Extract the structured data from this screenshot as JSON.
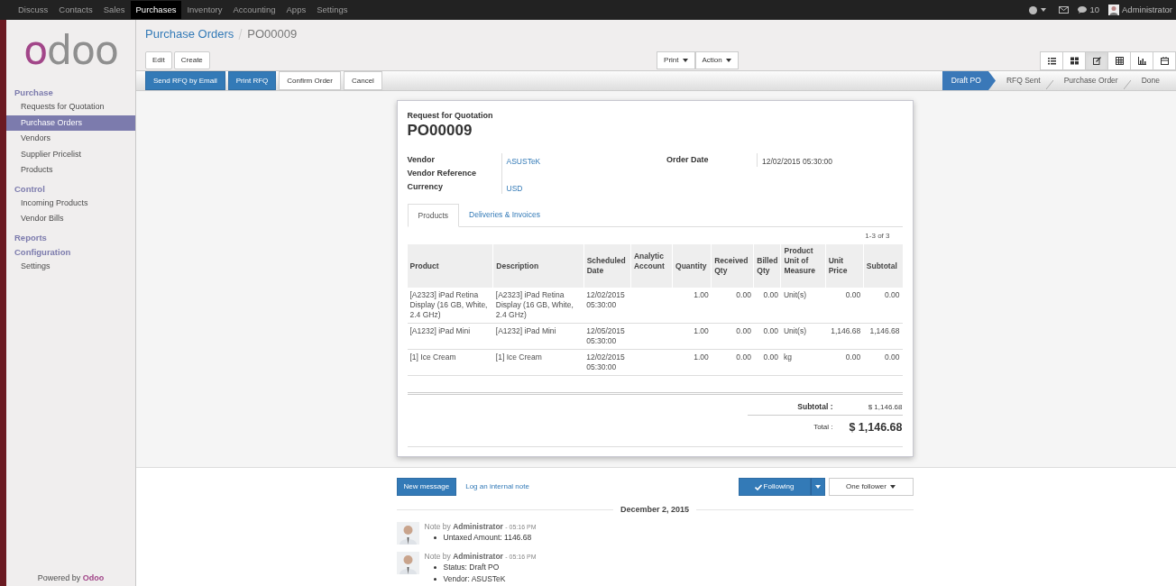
{
  "top_menu": [
    {
      "label": "Discuss",
      "selected": false
    },
    {
      "label": "Contacts",
      "selected": false
    },
    {
      "label": "Sales",
      "selected": false
    },
    {
      "label": "Purchases",
      "selected": true
    },
    {
      "label": "Inventory",
      "selected": false
    },
    {
      "label": "Accounting",
      "selected": false
    },
    {
      "label": "Apps",
      "selected": false
    },
    {
      "label": "Settings",
      "selected": false
    }
  ],
  "top_right": {
    "message_count": "10",
    "user": "Administrator"
  },
  "logo": "odoo",
  "sidebar": {
    "sections": [
      {
        "title": "Purchase",
        "items": [
          {
            "label": "Requests for Quotation",
            "selected": false
          },
          {
            "label": "Purchase Orders",
            "selected": true
          },
          {
            "label": "Vendors",
            "selected": false
          },
          {
            "label": "Supplier Pricelist",
            "selected": false
          },
          {
            "label": "Products",
            "selected": false
          }
        ]
      },
      {
        "title": "Control",
        "items": [
          {
            "label": "Incoming Products",
            "selected": false
          },
          {
            "label": "Vendor Bills",
            "selected": false
          }
        ]
      },
      {
        "title": "Reports"
      },
      {
        "title": "Configuration",
        "items": [
          {
            "label": "Settings",
            "selected": false
          }
        ]
      }
    ],
    "footer_prefix": "Powered by",
    "footer_brand": "Odoo"
  },
  "breadcrumb": {
    "parent": "Purchase Orders",
    "current": "PO00009"
  },
  "toolbar": {
    "left_buttons": [
      "Edit",
      "Create"
    ],
    "dropdowns": [
      "Print",
      "Action"
    ],
    "views": [
      {
        "kind": "list",
        "selected": false
      },
      {
        "kind": "kanban",
        "selected": false
      },
      {
        "kind": "form",
        "selected": true
      },
      {
        "kind": "pivot",
        "selected": false
      },
      {
        "kind": "graph",
        "selected": false
      },
      {
        "kind": "calendar",
        "selected": false
      }
    ]
  },
  "action_buttons": [
    {
      "label": "Send RFQ by Email",
      "primary": true
    },
    {
      "label": "Print RFQ",
      "primary": true
    },
    {
      "label": "Confirm Order",
      "primary": false
    },
    {
      "label": "Cancel",
      "primary": false
    }
  ],
  "status_steps": [
    {
      "label": "Draft PO",
      "selected": true
    },
    {
      "label": "RFQ Sent",
      "selected": false
    },
    {
      "label": "Purchase Order",
      "selected": false
    },
    {
      "label": "Done",
      "selected": false
    }
  ],
  "form": {
    "subtitle": "Request for Quotation",
    "title": "PO00009",
    "left_fields": [
      {
        "label": "Vendor",
        "value": "ASUSTeK"
      },
      {
        "label": "Vendor Reference"
      },
      {
        "label": "Currency",
        "value": "USD"
      }
    ],
    "right_fields": [
      {
        "label": "Order Date",
        "value": "12/02/2015 05:30:00"
      }
    ],
    "tabs": [
      {
        "label": "Products",
        "selected": true
      },
      {
        "label": "Deliveries & Invoices",
        "selected": false
      }
    ],
    "pager": "1-3 of 3",
    "table": {
      "columns": [
        "Product",
        "Description",
        "Scheduled Date",
        "Analytic Account",
        "Quantity",
        "Received Qty",
        "Billed Qty",
        "Product Unit of Measure",
        "Unit Price",
        "Subtotal"
      ],
      "rows": [
        [
          "[A2323] iPad Retina Display (16 GB, White, 2.4 GHz)",
          "[A2323] iPad Retina Display (16 GB, White, 2.4 GHz)",
          "12/02/2015 05:30:00",
          "",
          "1.00",
          "0.00",
          "0.00",
          "Unit(s)",
          "0.00",
          "0.00"
        ],
        [
          "[A1232] iPad Mini",
          "[A1232] iPad Mini",
          "12/05/2015 05:30:00",
          "",
          "1.00",
          "0.00",
          "0.00",
          "Unit(s)",
          "1,146.68",
          "1,146.68"
        ],
        [
          "[1] Ice Cream",
          "[1] Ice Cream",
          "12/02/2015 05:30:00",
          "",
          "1.00",
          "0.00",
          "0.00",
          "kg",
          "0.00",
          "0.00"
        ]
      ]
    },
    "subtotal_label": "Subtotal :",
    "subtotal": "$ 1,146.68",
    "total_label": "Total :",
    "total": "$ 1,146.68"
  },
  "chatter": {
    "new_message": "New message",
    "log_note": "Log an internal note",
    "following": "Following",
    "followers": "One follower",
    "date": "December 2, 2015",
    "messages": [
      {
        "prefix": "Note by",
        "author": "Administrator",
        "time": "- 05:16 PM",
        "lines": [
          "Untaxed Amount: 1146.68"
        ]
      },
      {
        "prefix": "Note by",
        "author": "Administrator",
        "time": "- 05:16 PM",
        "lines": [
          "Status: Draft PO",
          "Vendor: ASUSTeK"
        ]
      }
    ]
  }
}
